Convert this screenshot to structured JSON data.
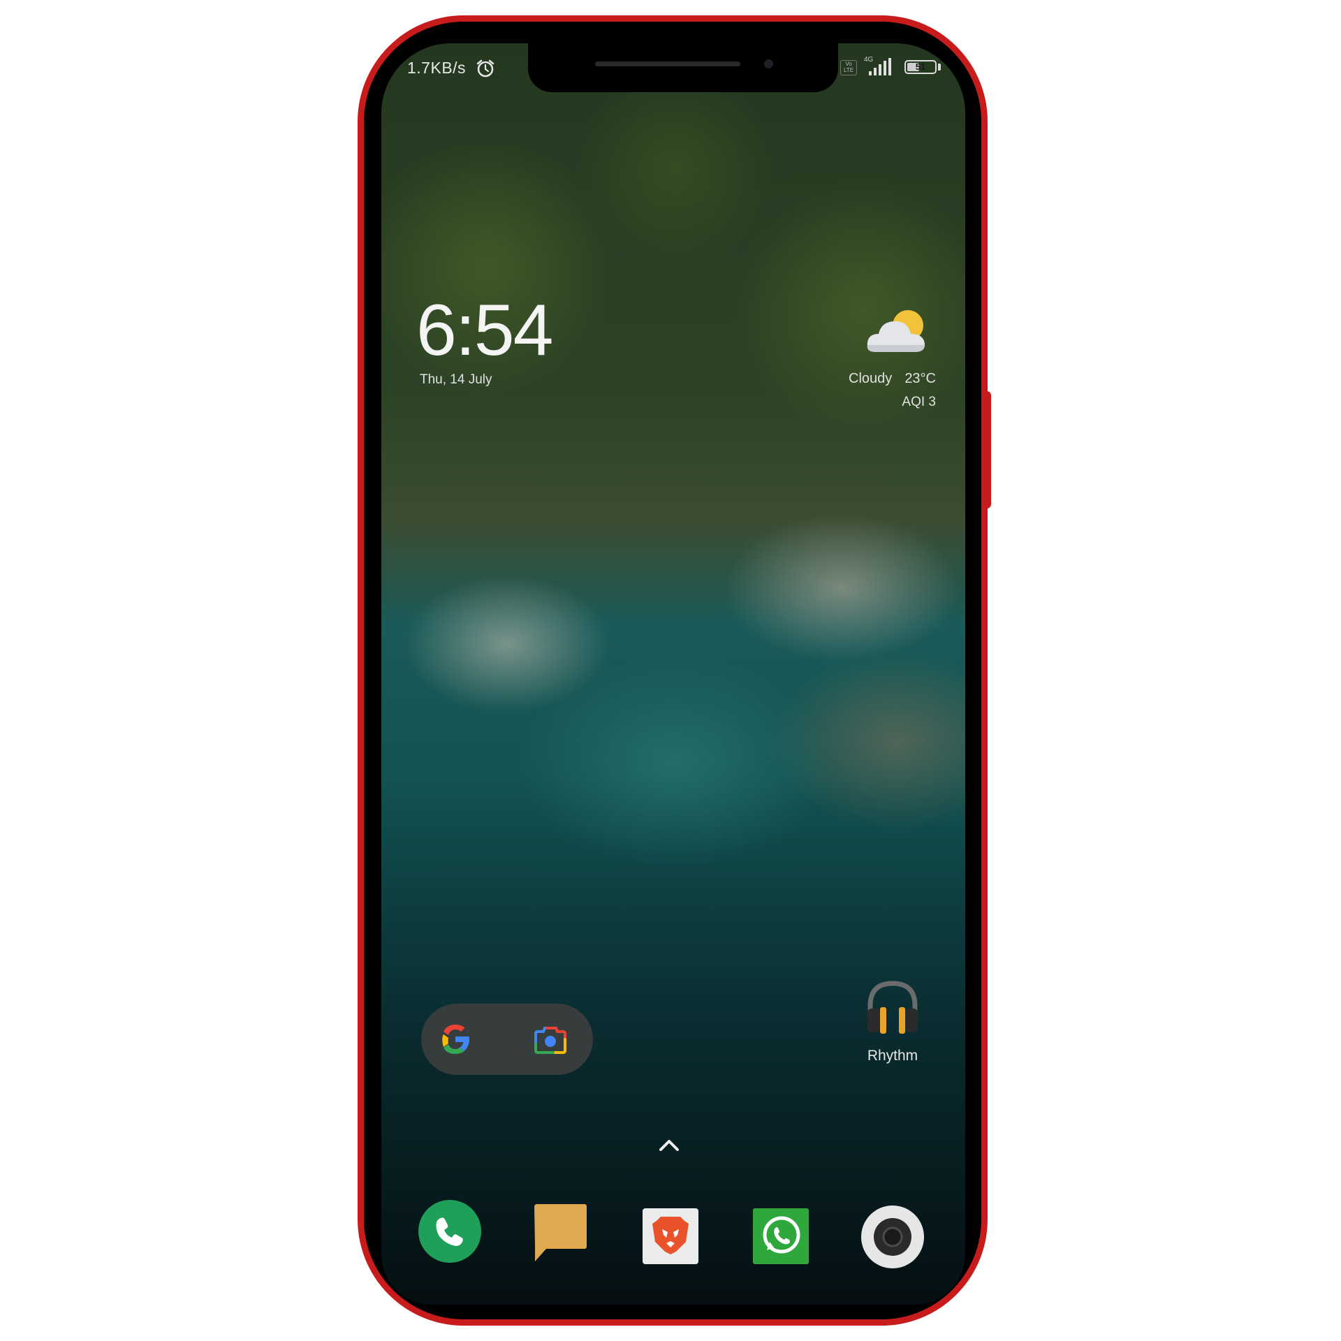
{
  "status_bar": {
    "network_speed": "1.7KB/s",
    "alarm_icon": "alarm-clock-icon",
    "volte_label": "Vo LTE",
    "network_type": "4G",
    "signal_icon": "signal-bars-icon",
    "battery_level": "51",
    "battery_fraction": 0.51
  },
  "clock_widget": {
    "time": "6:54",
    "date": "Thu, 14 July"
  },
  "weather_widget": {
    "icon": "partly-cloudy-icon",
    "condition": "Cloudy",
    "temperature": "23°C",
    "aqi": "AQI 3"
  },
  "search_widget": {
    "google_icon": "google-g-icon",
    "lens_icon": "google-lens-icon"
  },
  "home_apps": [
    {
      "label": "Rhythm",
      "icon": "headphones-icon"
    }
  ],
  "app_drawer_icon": "chevron-up-icon",
  "dock": [
    {
      "name": "Phone",
      "icon": "phone-icon",
      "color": "#1fa05a"
    },
    {
      "name": "Messages",
      "icon": "message-icon",
      "color": "#e0a850"
    },
    {
      "name": "Brave",
      "icon": "brave-lion-icon",
      "color": "#e8532b"
    },
    {
      "name": "WhatsApp",
      "icon": "whatsapp-icon",
      "color": "#2ea83c"
    },
    {
      "name": "Camera",
      "icon": "camera-icon",
      "color": "#e6e6e6"
    }
  ],
  "colors": {
    "frame": "#c81b1b",
    "text": "#f4f4f4"
  }
}
